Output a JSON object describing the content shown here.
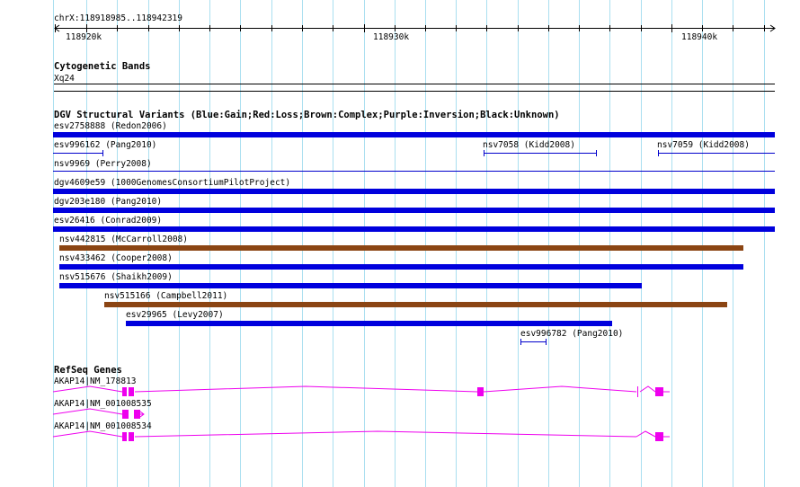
{
  "ruler": {
    "location": "chrX:118918985..118942319",
    "ticks": [
      "118920k",
      "118930k",
      "118940k"
    ]
  },
  "cytoband": {
    "title": "Cytogenetic Bands",
    "band": "Xq24"
  },
  "dgv": {
    "title": "DGV Structural Variants (Blue:Gain;Red:Loss;Brown:Complex;Purple:Inversion;Black:Unknown)",
    "colors": {
      "gain": "#0000dd",
      "complex": "#8b4513",
      "thin": "#0000cc"
    },
    "variants": [
      {
        "label": "esv2758888 (Redon2006)",
        "type": "gain"
      },
      {
        "label": "esv996162 (Pang2010)",
        "type": "thin"
      },
      {
        "label": "nsv7058 (Kidd2008)",
        "type": "thin"
      },
      {
        "label": "nsv7059 (Kidd2008)",
        "type": "thin"
      },
      {
        "label": "nsv9969 (Perry2008)",
        "type": "thin"
      },
      {
        "label": "dgv4609e59 (1000GenomesConsortiumPilotProject)",
        "type": "gain"
      },
      {
        "label": "dgv203e180 (Pang2010)",
        "type": "gain"
      },
      {
        "label": "esv26416 (Conrad2009)",
        "type": "gain"
      },
      {
        "label": "nsv442815 (McCarroll2008)",
        "type": "complex"
      },
      {
        "label": "nsv433462 (Cooper2008)",
        "type": "gain"
      },
      {
        "label": "nsv515676 (Shaikh2009)",
        "type": "gain"
      },
      {
        "label": "nsv515166 (Campbell2011)",
        "type": "complex"
      },
      {
        "label": "esv29965 (Levy2007)",
        "type": "gain"
      },
      {
        "label": "esv996782 (Pang2010)",
        "type": "thin"
      }
    ]
  },
  "refseq": {
    "title": "RefSeq Genes",
    "color": "#ee00ee",
    "transcripts": [
      {
        "label": "AKAP14|NM_178813"
      },
      {
        "label": "AKAP14|NM_001008535"
      },
      {
        "label": "AKAP14|NM_001008534"
      }
    ]
  }
}
